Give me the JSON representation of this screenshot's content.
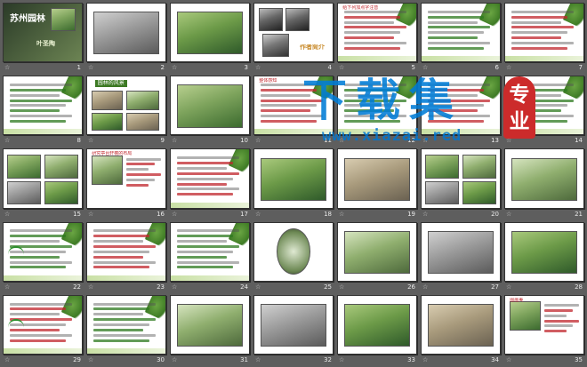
{
  "slides": [
    {
      "n": "1",
      "title": "苏州园林",
      "sub": "叶圣陶"
    },
    {
      "n": "2"
    },
    {
      "n": "3"
    },
    {
      "n": "4",
      "caption": "作者简介"
    },
    {
      "n": "5",
      "text": "给下列加点字注音"
    },
    {
      "n": "6"
    },
    {
      "n": "7"
    },
    {
      "n": "8"
    },
    {
      "n": "9",
      "title": "园林的风景"
    },
    {
      "n": "10"
    },
    {
      "n": "11",
      "text": "整体感知"
    },
    {
      "n": "12"
    },
    {
      "n": "13"
    },
    {
      "n": "14",
      "text": "合作探究"
    },
    {
      "n": "15"
    },
    {
      "n": "16",
      "text": "研究亭台轩榭的布局"
    },
    {
      "n": "17"
    },
    {
      "n": "18"
    },
    {
      "n": "19"
    },
    {
      "n": "20"
    },
    {
      "n": "21"
    },
    {
      "n": "22"
    },
    {
      "n": "23"
    },
    {
      "n": "24"
    },
    {
      "n": "25"
    },
    {
      "n": "26"
    },
    {
      "n": "27"
    },
    {
      "n": "28"
    },
    {
      "n": "29"
    },
    {
      "n": "30"
    },
    {
      "n": "31"
    },
    {
      "n": "32"
    },
    {
      "n": "33"
    },
    {
      "n": "34"
    },
    {
      "n": "35",
      "text": "图画美"
    }
  ],
  "watermark": {
    "cn": "下载集",
    "url": "www.xiazai.red",
    "badge": "专业"
  },
  "colors": {
    "background": "#5e5e5e",
    "accent": "#c0272d",
    "green": "#2e7a1f",
    "watermark": "#0078d4"
  }
}
